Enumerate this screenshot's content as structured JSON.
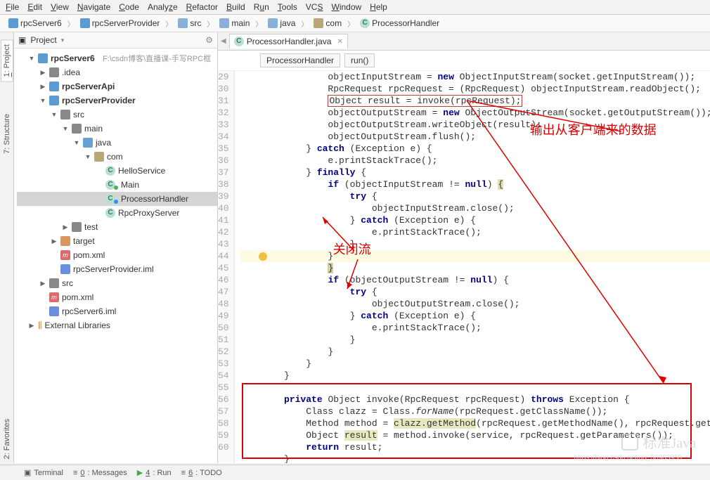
{
  "menu": [
    "File",
    "Edit",
    "View",
    "Navigate",
    "Code",
    "Analyze",
    "Refactor",
    "Build",
    "Run",
    "Tools",
    "VCS",
    "Window",
    "Help"
  ],
  "breadcrumb": [
    "rpcServer6",
    "rpcServerProvider",
    "src",
    "main",
    "java",
    "com",
    "ProcessorHandler"
  ],
  "projectPanel": {
    "title": "Project"
  },
  "tree": {
    "root": "rpcServer6",
    "rootHint": "F:\\csdn博客\\直播课-手写RPC框",
    "idea": ".idea",
    "api": "rpcServerApi",
    "provider": "rpcServerProvider",
    "src": "src",
    "main": "main",
    "java": "java",
    "com": "com",
    "hello": "HelloService",
    "mainCls": "Main",
    "proc": "ProcessorHandler",
    "proxy": "RpcProxyServer",
    "test": "test",
    "target": "target",
    "pom1": "pom.xml",
    "iml1": "rpcServerProvider.iml",
    "src2": "src",
    "pom2": "pom.xml",
    "iml2": "rpcServer6.iml",
    "ext": "External Libraries"
  },
  "editor": {
    "tab": "ProcessorHandler.java",
    "crumb1": "ProcessorHandler",
    "crumb2": "run()"
  },
  "gutterStart": 29,
  "gutterEnd": 60,
  "code": [
    "                objectInputStream = new ObjectInputStream(socket.getInputStream());",
    "                RpcRequest rpcRequest = (RpcRequest) objectInputStream.readObject();",
    "                Object result = invoke(rpcRequest);",
    "                objectOutputStream = new ObjectOutputStream(socket.getOutputStream());",
    "                objectOutputStream.writeObject(result);",
    "                objectOutputStream.flush();",
    "            } catch (Exception e) {",
    "                e.printStackTrace();",
    "            } finally {",
    "                if (objectInputStream != null) {",
    "                    try {",
    "                        objectInputStream.close();",
    "                    } catch (Exception e) {",
    "                        e.printStackTrace();",
    "                    }",
    "                }",
    "                }",
    "                if (objectOutputStream != null) {",
    "                    try {",
    "                        objectOutputStream.close();",
    "                    } catch (Exception e) {",
    "                        e.printStackTrace();",
    "                    }",
    "                }",
    "            }",
    "        }",
    "",
    "        private Object invoke(RpcRequest rpcRequest) throws Exception {",
    "            Class clazz = Class.forName(rpcRequest.getClassName());",
    "            Method method = clazz.getMethod(rpcRequest.getMethodName(), rpcRequest.getType());",
    "            Object result = method.invoke(service, rpcRequest.getParameters());",
    "            return result;",
    "        }"
  ],
  "annotations": {
    "a1": "输出从客户端来的数据",
    "a2": "关闭流"
  },
  "bottom": {
    "terminal": "Terminal",
    "messages": "0: Messages",
    "run": "4: Run",
    "todo": "6: TODO"
  },
  "watermark": "标准Java",
  "watermarkUrl": "https://blog.csdn.net/qq_36963950"
}
